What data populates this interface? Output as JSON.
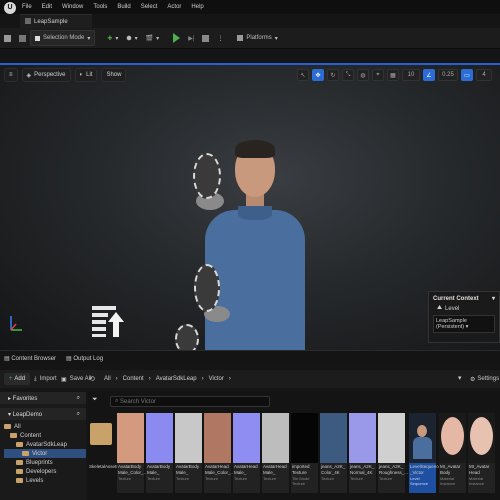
{
  "menubar": {
    "logo": "U",
    "items": [
      "File",
      "Edit",
      "Window",
      "Tools",
      "Build",
      "Select",
      "Actor",
      "Help"
    ],
    "project_tab": "LeapSample"
  },
  "toolbar": {
    "mode_label": "Selection Mode",
    "platforms_label": "Platforms"
  },
  "viewport": {
    "view_mode": "Perspective",
    "lit_mode": "Lit",
    "show_label": "Show",
    "snap_value": "0.25",
    "camera_speed": "4"
  },
  "current_context": {
    "title": "Current Context",
    "level_label": "Level",
    "level_value": "LeapSample (Persistent)"
  },
  "bottom_tabs": {
    "content_browser": "Content Browser",
    "output_log": "Output Log"
  },
  "content_browser": {
    "add_label": "Add",
    "import_label": "Import",
    "save_all_label": "Save All",
    "breadcrumb": [
      "All",
      "Content",
      "AvatarSdkLeap",
      "Victor"
    ],
    "settings_label": "Settings",
    "search_placeholder": "Search Victor",
    "favorites_label": "Favorites",
    "project_label": "LeapDemo",
    "tree": [
      "All",
      "Content",
      "AvatarSdkLeap",
      "Victor",
      "Blueprints",
      "Developers",
      "Levels"
    ]
  },
  "assets": [
    {
      "name": "SkeletalAssets",
      "type": ""
    },
    {
      "name": "AvatarBody Male_Color_...",
      "type": "Texture"
    },
    {
      "name": "AvatarBody Male_",
      "type": "Texture"
    },
    {
      "name": "AvatarBody Male_",
      "type": "Texture"
    },
    {
      "name": "AvatarHead Male_Color_...",
      "type": "Texture"
    },
    {
      "name": "AvatarHead Male_",
      "type": "Texture"
    },
    {
      "name": "AvatarHead Male_",
      "type": "Texture"
    },
    {
      "name": "imported Texture",
      "type": "Tile Mode Texture"
    },
    {
      "name": "jeans_A2K_ Color_4K",
      "type": "Texture"
    },
    {
      "name": "jeans_A2K_ Normal_4K",
      "type": "Texture"
    },
    {
      "name": "jeans_A2K_ Roughness_...",
      "type": "Texture"
    },
    {
      "name": "LevelSequence _Victor",
      "type": "Level Sequence"
    },
    {
      "name": "MI_Avatar Body",
      "type": "Material Instance"
    },
    {
      "name": "MI_Avatar Head",
      "type": "Material Instance"
    }
  ],
  "colors": {
    "accent": "#2b6cd6",
    "play": "#4caf50",
    "folder": "#c9a26a"
  }
}
